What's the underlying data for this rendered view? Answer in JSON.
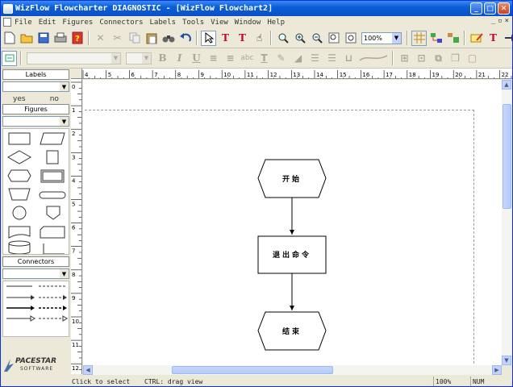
{
  "window": {
    "title": "WizFlow Flowcharter DIAGNOSTIC - [WizFlow Flowchart2]",
    "min": "_",
    "max": "□",
    "close": "✕"
  },
  "menu": [
    "File",
    "Edit",
    "Figures",
    "Connectors",
    "Labels",
    "Tools",
    "View",
    "Window",
    "Help"
  ],
  "toolbar": {
    "zoom_value": "100%"
  },
  "left": {
    "labels_title": "Labels",
    "labels_options": [
      "yes",
      "no"
    ],
    "figures_title": "Figures",
    "connectors_title": "Connectors",
    "brand_name": "PACESTAR",
    "brand_sub": "SOFTWARE"
  },
  "ruler": {
    "h": [
      "4",
      "5",
      "6",
      "7",
      "8",
      "9",
      "10",
      "11",
      "12",
      "13",
      "14",
      "15",
      "16",
      "17",
      "18",
      "19",
      "20",
      "21",
      "22"
    ],
    "v": [
      "0",
      "1",
      "2",
      "3",
      "4",
      "5",
      "6",
      "7",
      "8",
      "9",
      "10",
      "11",
      "12"
    ]
  },
  "flowchart": {
    "start": "开始",
    "process": "退出命令",
    "end": "结束"
  },
  "status": {
    "hint": "Click to select",
    "ctrl": "CTRL: drag view",
    "zoom": "100%",
    "num": "NUM"
  },
  "colors": {
    "title_bar": "#0a5fd6",
    "face": "#ece9d8",
    "scroll_thumb": "#c3d3fd"
  }
}
